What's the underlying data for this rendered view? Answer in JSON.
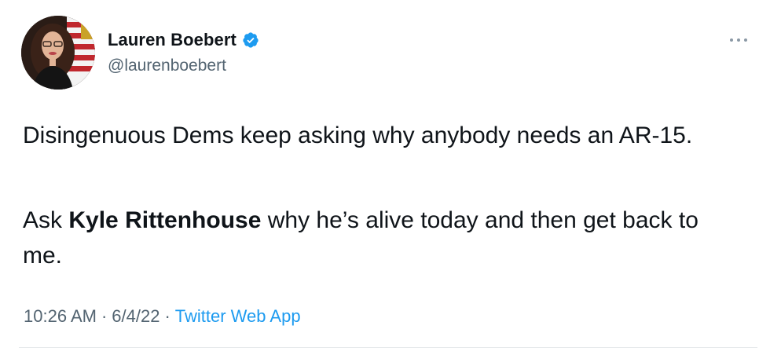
{
  "tweet": {
    "author": {
      "display_name": "Lauren Boebert",
      "handle": "@laurenboebert",
      "verified": true,
      "avatar_icon": "profile-photo-avatar"
    },
    "menu_icon": "more-options-icon",
    "body": {
      "paragraph1": "Disingenuous Dems keep asking why anybody needs an AR-15.",
      "paragraph2_prefix": "Ask ",
      "paragraph2_bold": "Kyle Rittenhouse",
      "paragraph2_suffix": " why he’s alive today and then get back to me."
    },
    "meta": {
      "time": "10:26 AM",
      "separator1": "·",
      "date": "6/4/22",
      "separator2": "·",
      "source": "Twitter Web App"
    },
    "colors": {
      "text": "#0f1419",
      "secondary": "#536471",
      "link": "#1d9bf0",
      "verified_badge": "#1d9bf0"
    }
  }
}
